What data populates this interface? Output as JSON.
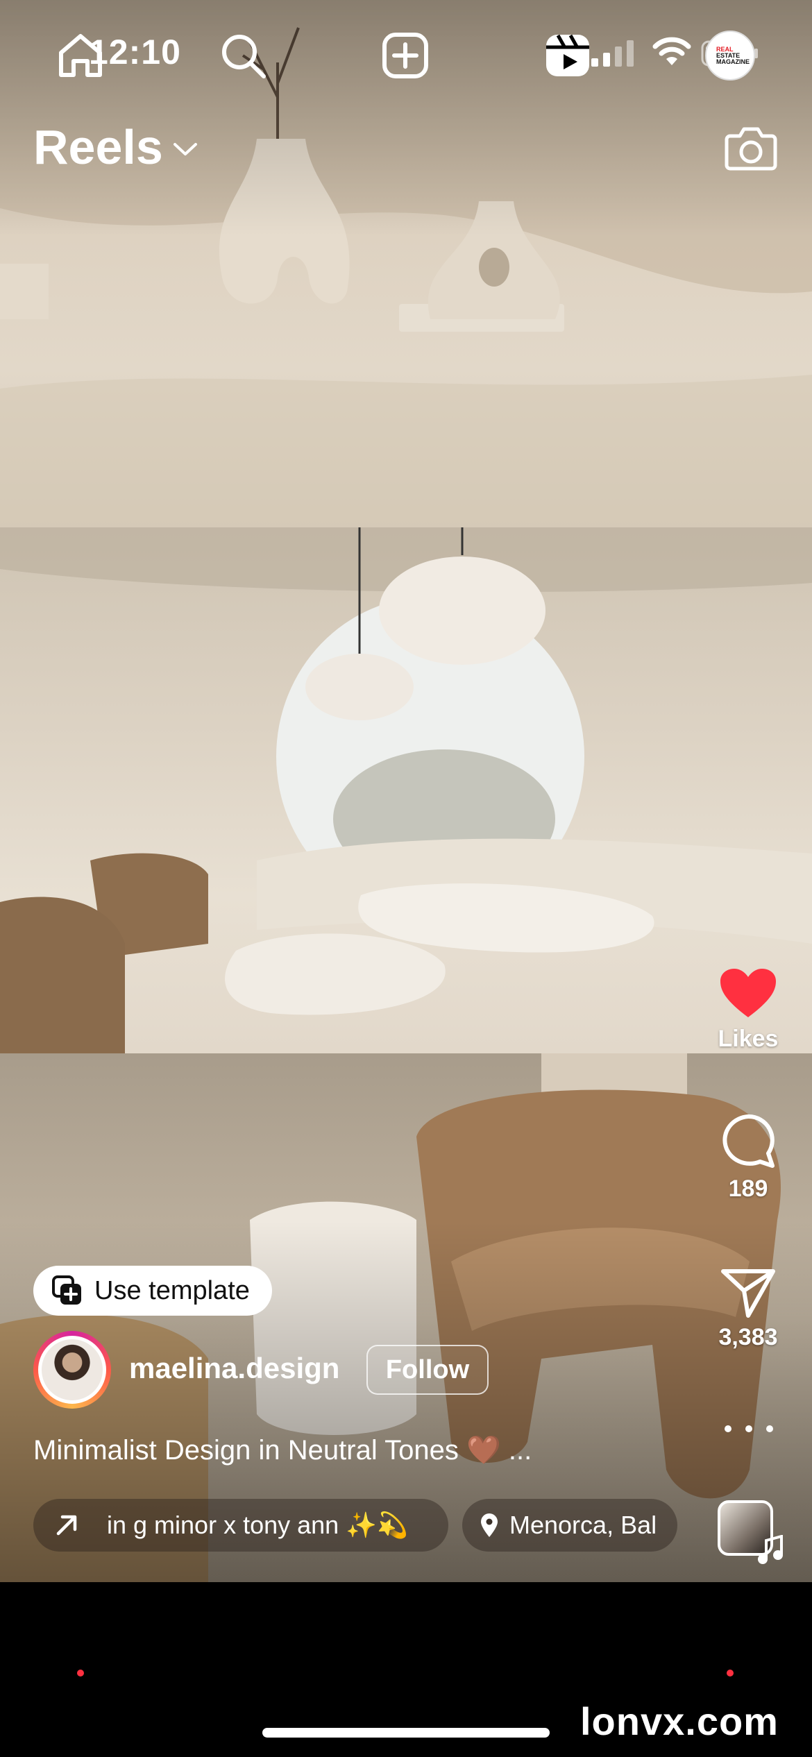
{
  "status_bar": {
    "time": "12:10"
  },
  "header": {
    "title": "Reels"
  },
  "actions": {
    "likes_label": "Likes",
    "comments_count": "189",
    "shares_count": "3,383"
  },
  "post": {
    "use_template_label": "Use template",
    "username": "maelina.design",
    "follow_label": "Follow",
    "caption": "Minimalist Design in Neutral Tones 🤎 ...",
    "audio": "in g minor x tony ann ✨💫",
    "location": "Menorca, Bal"
  },
  "nav": {
    "items": [
      "home",
      "search",
      "create",
      "reels",
      "profile"
    ],
    "profile_badge": [
      "REAL",
      "ESTATE",
      "MAGAZINE"
    ]
  },
  "watermark": "lonvx.com",
  "colors": {
    "like": "#ff3040",
    "accent": "#ff3040"
  }
}
